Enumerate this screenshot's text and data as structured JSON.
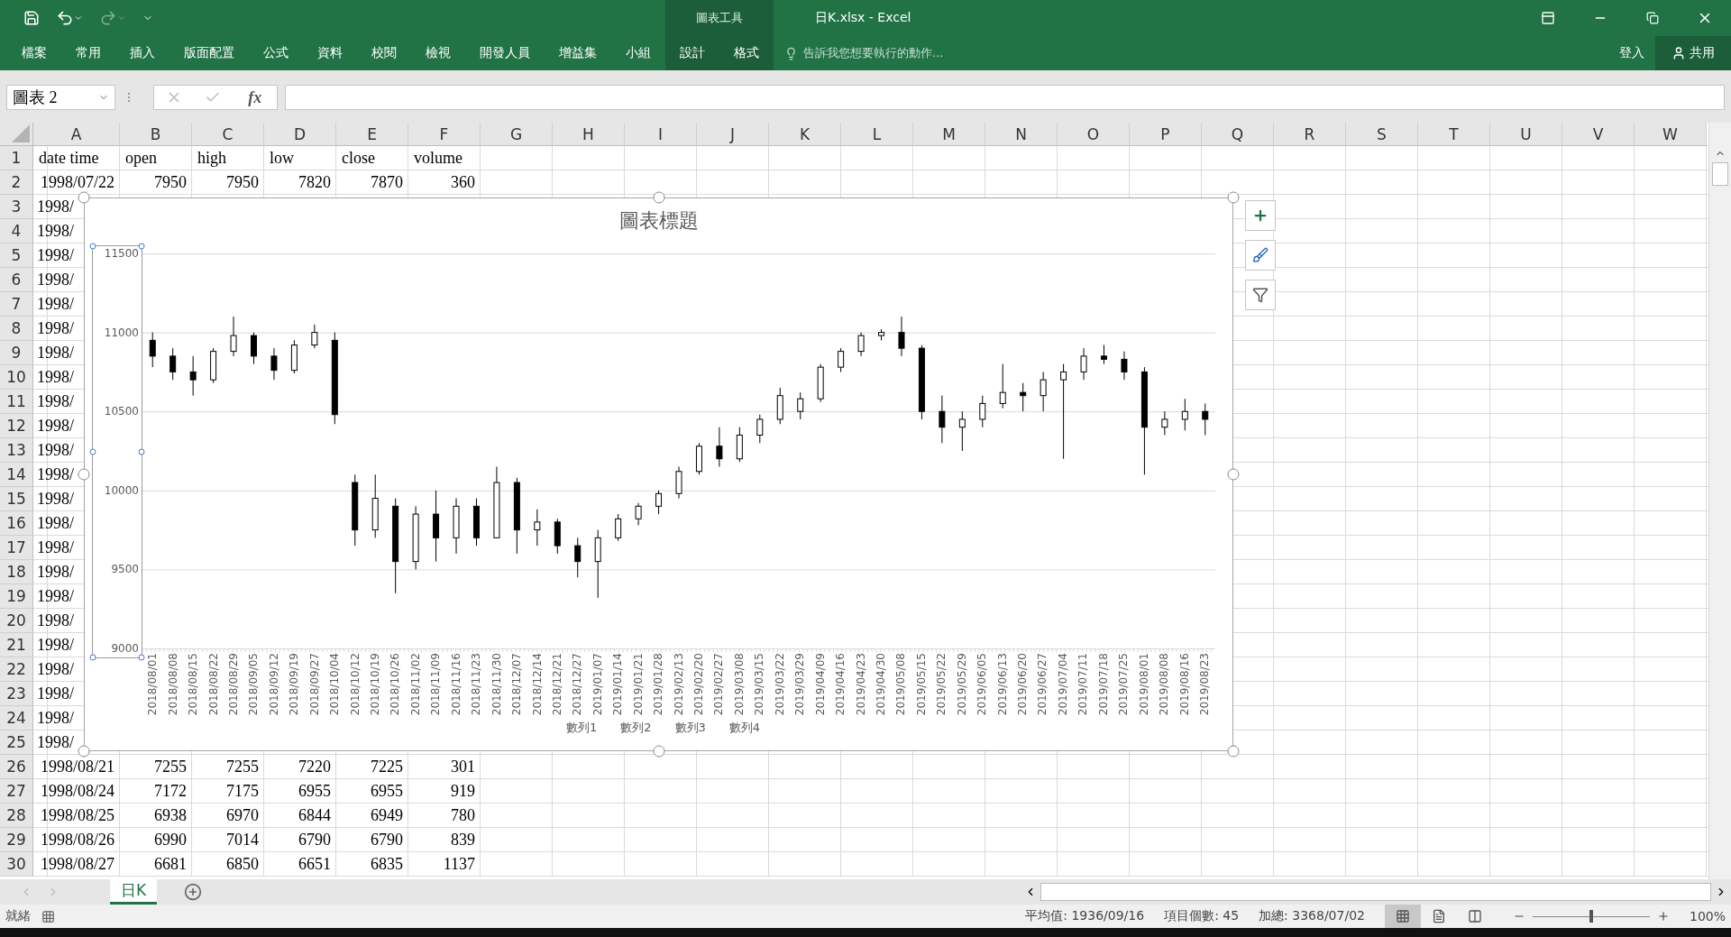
{
  "window": {
    "title": "日K.xlsx - Excel",
    "context_group": "圖表工具"
  },
  "ribbon_tabs": [
    {
      "label": "檔案",
      "kind": "normal"
    },
    {
      "label": "常用",
      "kind": "normal"
    },
    {
      "label": "插入",
      "kind": "normal"
    },
    {
      "label": "版面配置",
      "kind": "normal"
    },
    {
      "label": "公式",
      "kind": "normal"
    },
    {
      "label": "資料",
      "kind": "normal"
    },
    {
      "label": "校閱",
      "kind": "normal"
    },
    {
      "label": "檢視",
      "kind": "normal"
    },
    {
      "label": "開發人員",
      "kind": "normal"
    },
    {
      "label": "增益集",
      "kind": "normal"
    },
    {
      "label": "小組",
      "kind": "normal"
    },
    {
      "label": "設計",
      "kind": "context"
    },
    {
      "label": "格式",
      "kind": "context"
    }
  ],
  "tell_me": "告訴我您想要執行的動作...",
  "sign_in": "登入",
  "share": "共用",
  "name_box": "圖表 2",
  "fx": "fx",
  "columns": [
    "A",
    "B",
    "C",
    "D",
    "E",
    "F",
    "G",
    "H",
    "I",
    "J",
    "K",
    "L",
    "M",
    "N",
    "O",
    "P",
    "Q",
    "R",
    "S",
    "T",
    "U",
    "V",
    "W"
  ],
  "rows": [
    {
      "number": "1",
      "kind": "header",
      "cells": [
        "date time",
        "open",
        "high",
        "low",
        "close",
        "volume"
      ]
    },
    {
      "number": "2",
      "kind": "data",
      "cells": [
        "1998/07/22",
        "7950",
        "7950",
        "7820",
        "7870",
        "360"
      ]
    },
    {
      "number": "3",
      "kind": "covered",
      "cells": [
        "1998/"
      ]
    },
    {
      "number": "4",
      "kind": "covered",
      "cells": [
        "1998/"
      ]
    },
    {
      "number": "5",
      "kind": "covered",
      "cells": [
        "1998/"
      ]
    },
    {
      "number": "6",
      "kind": "covered",
      "cells": [
        "1998/"
      ]
    },
    {
      "number": "7",
      "kind": "covered",
      "cells": [
        "1998/"
      ]
    },
    {
      "number": "8",
      "kind": "covered",
      "cells": [
        "1998/"
      ]
    },
    {
      "number": "9",
      "kind": "covered",
      "cells": [
        "1998/"
      ]
    },
    {
      "number": "10",
      "kind": "covered",
      "cells": [
        "1998/"
      ]
    },
    {
      "number": "11",
      "kind": "covered",
      "cells": [
        "1998/"
      ]
    },
    {
      "number": "12",
      "kind": "covered",
      "cells": [
        "1998/"
      ]
    },
    {
      "number": "13",
      "kind": "covered",
      "cells": [
        "1998/"
      ]
    },
    {
      "number": "14",
      "kind": "covered",
      "cells": [
        "1998/"
      ]
    },
    {
      "number": "15",
      "kind": "covered",
      "cells": [
        "1998/"
      ]
    },
    {
      "number": "16",
      "kind": "covered",
      "cells": [
        "1998/"
      ]
    },
    {
      "number": "17",
      "kind": "covered",
      "cells": [
        "1998/"
      ]
    },
    {
      "number": "18",
      "kind": "covered",
      "cells": [
        "1998/"
      ]
    },
    {
      "number": "19",
      "kind": "covered",
      "cells": [
        "1998/"
      ]
    },
    {
      "number": "20",
      "kind": "covered",
      "cells": [
        "1998/"
      ]
    },
    {
      "number": "21",
      "kind": "covered",
      "cells": [
        "1998/"
      ]
    },
    {
      "number": "22",
      "kind": "covered",
      "cells": [
        "1998/"
      ]
    },
    {
      "number": "23",
      "kind": "covered",
      "cells": [
        "1998/"
      ]
    },
    {
      "number": "24",
      "kind": "covered",
      "cells": [
        "1998/"
      ]
    },
    {
      "number": "25",
      "kind": "covered",
      "cells": [
        "1998/"
      ]
    },
    {
      "number": "26",
      "kind": "data",
      "cells": [
        "1998/08/21",
        "7255",
        "7255",
        "7220",
        "7225",
        "301"
      ]
    },
    {
      "number": "27",
      "kind": "data",
      "cells": [
        "1998/08/24",
        "7172",
        "7175",
        "6955",
        "6955",
        "919"
      ]
    },
    {
      "number": "28",
      "kind": "data",
      "cells": [
        "1998/08/25",
        "6938",
        "6970",
        "6844",
        "6949",
        "780"
      ]
    },
    {
      "number": "29",
      "kind": "data",
      "cells": [
        "1998/08/26",
        "6990",
        "7014",
        "6790",
        "6790",
        "839"
      ]
    },
    {
      "number": "30",
      "kind": "data",
      "cells": [
        "1998/08/27",
        "6681",
        "6850",
        "6651",
        "6835",
        "1137"
      ]
    }
  ],
  "chart": {
    "chart_data": {
      "type": "candlestick",
      "title": "圖表標題",
      "ylim": [
        9000,
        11500
      ],
      "grid": true,
      "yticks": [
        9000,
        9500,
        10000,
        10500,
        11000,
        11500
      ],
      "ohlc": [
        [
          10950,
          11000,
          10780,
          10850
        ],
        [
          10850,
          10900,
          10700,
          10750
        ],
        [
          10750,
          10850,
          10600,
          10700
        ],
        [
          10700,
          10900,
          10680,
          10880
        ],
        [
          10880,
          11100,
          10850,
          10980
        ],
        [
          10980,
          11000,
          10800,
          10850
        ],
        [
          10850,
          10900,
          10700,
          10760
        ],
        [
          10760,
          10950,
          10740,
          10920
        ],
        [
          10920,
          11050,
          10900,
          11000
        ],
        [
          10950,
          11000,
          10420,
          10480
        ],
        [
          10050,
          10100,
          9650,
          9750
        ],
        [
          9750,
          10100,
          9700,
          9950
        ],
        [
          9900,
          9950,
          9350,
          9550
        ],
        [
          9550,
          9900,
          9500,
          9850
        ],
        [
          9850,
          10000,
          9550,
          9700
        ],
        [
          9700,
          9950,
          9600,
          9900
        ],
        [
          9900,
          9950,
          9650,
          9700
        ],
        [
          9700,
          10150,
          9700,
          10050
        ],
        [
          10050,
          10080,
          9600,
          9750
        ],
        [
          9750,
          9880,
          9650,
          9800
        ],
        [
          9800,
          9820,
          9600,
          9650
        ],
        [
          9650,
          9700,
          9450,
          9550
        ],
        [
          9550,
          9750,
          9320,
          9700
        ],
        [
          9700,
          9850,
          9680,
          9820
        ],
        [
          9820,
          9920,
          9780,
          9900
        ],
        [
          9900,
          10000,
          9850,
          9980
        ],
        [
          9980,
          10150,
          9950,
          10120
        ],
        [
          10120,
          10300,
          10100,
          10280
        ],
        [
          10280,
          10400,
          10150,
          10200
        ],
        [
          10200,
          10400,
          10180,
          10350
        ],
        [
          10350,
          10480,
          10300,
          10450
        ],
        [
          10450,
          10650,
          10420,
          10600
        ],
        [
          10500,
          10620,
          10450,
          10580
        ],
        [
          10580,
          10800,
          10560,
          10780
        ],
        [
          10780,
          10900,
          10750,
          10880
        ],
        [
          10880,
          11000,
          10850,
          10980
        ],
        [
          10980,
          11020,
          10950,
          11000
        ],
        [
          11000,
          11100,
          10850,
          10900
        ],
        [
          10900,
          10920,
          10450,
          10500
        ],
        [
          10500,
          10600,
          10300,
          10400
        ],
        [
          10400,
          10500,
          10250,
          10450
        ],
        [
          10450,
          10600,
          10400,
          10550
        ],
        [
          10550,
          10800,
          10520,
          10620
        ],
        [
          10620,
          10680,
          10500,
          10600
        ],
        [
          10600,
          10750,
          10500,
          10700
        ],
        [
          10700,
          10800,
          10200,
          10750
        ],
        [
          10750,
          10900,
          10700,
          10850
        ],
        [
          10850,
          10920,
          10800,
          10830
        ],
        [
          10830,
          10880,
          10700,
          10750
        ],
        [
          10750,
          10780,
          10100,
          10400
        ],
        [
          10400,
          10500,
          10350,
          10450
        ],
        [
          10450,
          10580,
          10380,
          10500
        ],
        [
          10500,
          10550,
          10350,
          10450
        ]
      ],
      "categories": [
        "2018/08/01",
        "2018/08/08",
        "2018/08/15",
        "2018/08/22",
        "2018/08/29",
        "2018/09/05",
        "2018/09/12",
        "2018/09/19",
        "2018/09/27",
        "2018/10/04",
        "2018/10/12",
        "2018/10/19",
        "2018/10/26",
        "2018/11/02",
        "2018/11/09",
        "2018/11/16",
        "2018/11/23",
        "2018/11/30",
        "2018/12/07",
        "2018/12/14",
        "2018/12/21",
        "2018/12/27",
        "2019/01/07",
        "2019/01/14",
        "2019/01/21",
        "2019/01/28",
        "2019/02/13",
        "2019/02/20",
        "2019/02/27",
        "2019/03/08",
        "2019/03/15",
        "2019/03/22",
        "2019/03/29",
        "2019/04/09",
        "2019/04/16",
        "2019/04/23",
        "2019/04/30",
        "2019/05/08",
        "2019/05/15",
        "2019/05/22",
        "2019/05/29",
        "2019/06/05",
        "2019/06/13",
        "2019/06/20",
        "2019/06/27",
        "2019/07/04",
        "2019/07/11",
        "2019/07/18",
        "2019/07/25",
        "2019/08/01",
        "2019/08/08",
        "2019/08/16",
        "2019/08/23"
      ]
    },
    "legend": [
      "數列1",
      "數列2",
      "數列3",
      "數列4"
    ]
  },
  "sheet_tabs": [
    {
      "label": "日K",
      "selected": true
    }
  ],
  "status": {
    "mode": "就緒",
    "average": "平均值: 1936/09/16",
    "count": "項目個數: 45",
    "sum": "加總: 3368/07/02",
    "zoom": "100%"
  },
  "zoom_slider": {
    "level": 0.5
  }
}
